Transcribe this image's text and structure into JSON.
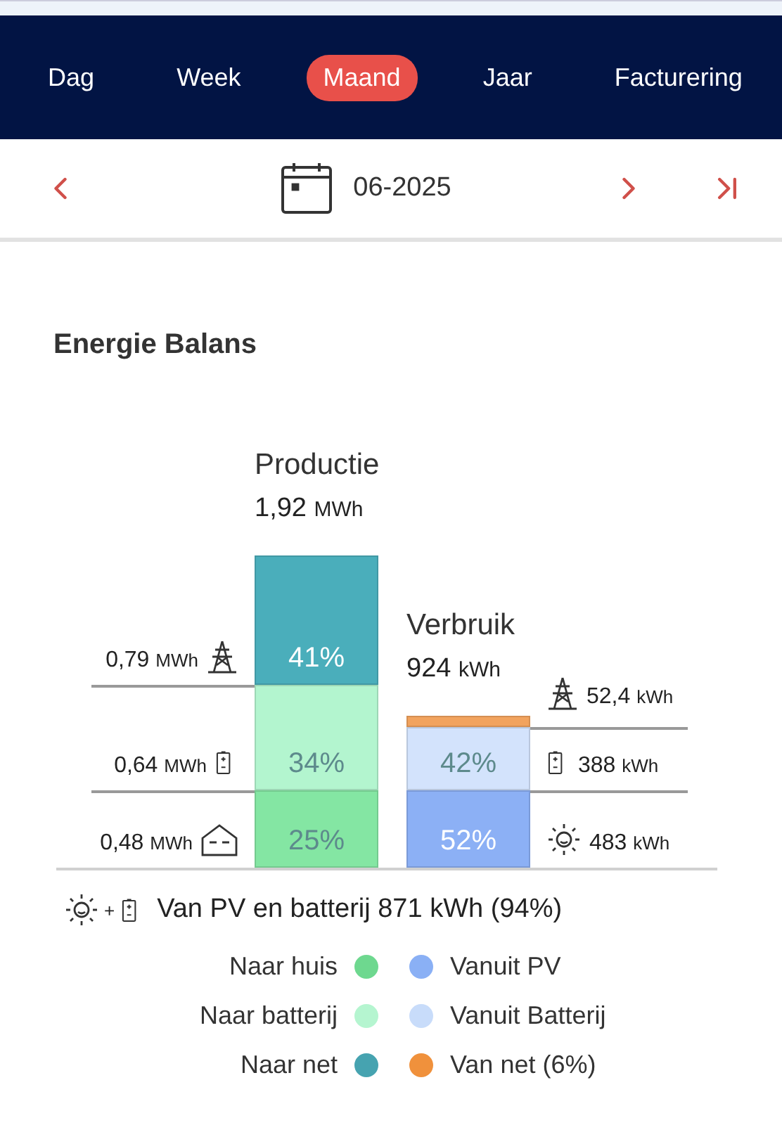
{
  "tabs": [
    {
      "label": "Dag",
      "selected": false
    },
    {
      "label": "Week",
      "selected": false
    },
    {
      "label": "Maand",
      "selected": true
    },
    {
      "label": "Jaar",
      "selected": false
    },
    {
      "label": "Facturering",
      "selected": false
    }
  ],
  "period": "06-2025",
  "section_title": "Energie Balans",
  "production": {
    "title": "Productie",
    "total": "1,92",
    "unit": "MWh",
    "segments": [
      {
        "kind": "grid",
        "percent": "41%",
        "value": "0,79",
        "unit": "MWh",
        "color": "#4aaebb"
      },
      {
        "kind": "battery",
        "percent": "34%",
        "value": "0,64",
        "unit": "MWh",
        "color": "#b3f5cf"
      },
      {
        "kind": "house",
        "percent": "25%",
        "value": "0,48",
        "unit": "MWh",
        "color": "#84e6a3"
      }
    ]
  },
  "consumption": {
    "title": "Verbruik",
    "total": "924",
    "unit": "kWh",
    "segments": [
      {
        "kind": "grid",
        "value": "52,4",
        "unit": "kWh",
        "color": "#f2a35e"
      },
      {
        "kind": "battery",
        "percent": "42%",
        "value": "388",
        "unit": "kWh",
        "color": "#d3e3fc"
      },
      {
        "kind": "pv",
        "percent": "52%",
        "value": "483",
        "unit": "kWh",
        "color": "#8cb0f5"
      }
    ]
  },
  "summary": {
    "joiner": "+",
    "text": "Van PV en batterij 871 kWh (94%)"
  },
  "legend": {
    "left": [
      {
        "label": "Naar huis",
        "color": "#6ed88f"
      },
      {
        "label": "Naar batterij",
        "color": "#b5f5d0"
      },
      {
        "label": "Naar net",
        "color": "#46a3b0"
      }
    ],
    "right": [
      {
        "label": "Vanuit PV",
        "color": "#8ab0f5"
      },
      {
        "label": "Vanuit Batterij",
        "color": "#c8dcfa"
      },
      {
        "label": "Van net (6%)",
        "color": "#f0913c"
      }
    ]
  }
}
